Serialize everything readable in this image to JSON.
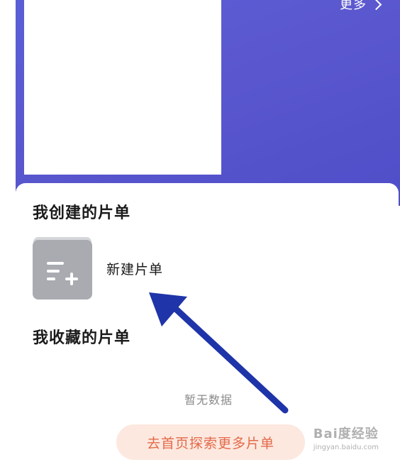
{
  "header": {
    "more_label": "更多"
  },
  "sections": {
    "created_title": "我创建的片单",
    "favorites_title": "我收藏的片单"
  },
  "new_list": {
    "label": "新建片单",
    "icon": "new-playlist-icon"
  },
  "favorites": {
    "empty_text": "暂无数据"
  },
  "explore": {
    "button_label": "去首页探索更多片单"
  },
  "watermark": {
    "main": "Bai度经验",
    "sub": "jingyan.baidu.com"
  },
  "colors": {
    "banner": "#5a5fd6",
    "accent_text": "#e26a4a",
    "accent_bg": "#fde8df",
    "icon_bg": "#a9abb1",
    "arrow": "#1e34a8"
  }
}
